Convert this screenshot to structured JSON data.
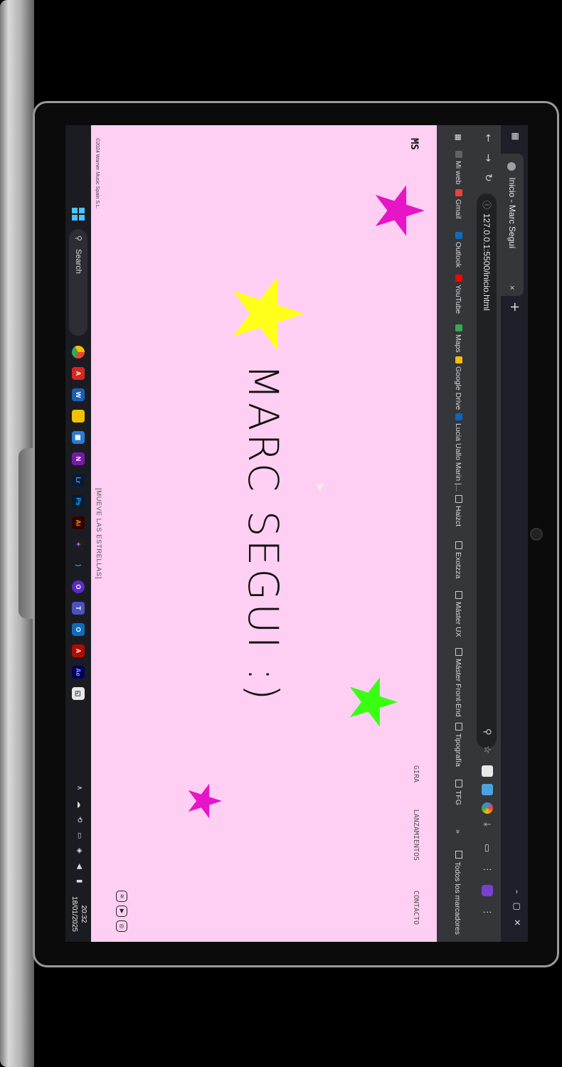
{
  "browser": {
    "tab_title": "Inicio - Marc Seguí",
    "tab_close": "×",
    "new_tab": "+",
    "url": "127.0.0.1:5500/inicio.html",
    "bookmarks": [
      {
        "label": "Mi web",
        "icon": "globe-icon",
        "color": "#5f6368"
      },
      {
        "label": "Gmail",
        "icon": "gmail-icon",
        "color": "#ea4335"
      },
      {
        "label": "Outlook",
        "icon": "outlook-icon",
        "color": "#0f6cbd"
      },
      {
        "label": "YouTube",
        "icon": "youtube-icon",
        "color": "#ff0000"
      },
      {
        "label": "Maps",
        "icon": "maps-icon",
        "color": "#34a853"
      },
      {
        "label": "Google Drive",
        "icon": "drive-icon",
        "color": "#fbbc04"
      },
      {
        "label": "Lucia Uallo Marin |...",
        "icon": "linkedin-icon",
        "color": "#0a66c2"
      },
      {
        "label": "Haizct",
        "icon": "folder-icon",
        "color": "none"
      },
      {
        "label": "Exotzza",
        "icon": "folder-icon",
        "color": "none"
      },
      {
        "label": "Máster UX",
        "icon": "folder-icon",
        "color": "none"
      },
      {
        "label": "Máster Front-End",
        "icon": "folder-icon",
        "color": "none"
      },
      {
        "label": "Tipografía",
        "icon": "folder-icon",
        "color": "none"
      },
      {
        "label": "TFG",
        "icon": "folder-icon",
        "color": "none"
      }
    ],
    "all_bookmarks": "Todos los marcadores"
  },
  "site": {
    "logo": "MS",
    "nav": [
      "GIRA",
      "LANZAMIENTOS",
      "CONTACTO"
    ],
    "hero_title": "MARC SEGUI :)",
    "hint": "[MUEVE LAS ESTRELLAS]",
    "copyright": "©2024 Warner Music Spain S.L.",
    "socials": [
      "spotify-icon",
      "youtube-icon",
      "instagram-icon"
    ],
    "stars": [
      {
        "name": "star-magenta-top",
        "color": "#e815c8"
      },
      {
        "name": "star-yellow",
        "color": "#ffff1a"
      },
      {
        "name": "star-green",
        "color": "#39ff14"
      },
      {
        "name": "star-magenta-bottom",
        "color": "#e815c8"
      }
    ]
  },
  "taskbar": {
    "search_label": "Search",
    "time": "20:32",
    "date": "18/01/2025"
  }
}
